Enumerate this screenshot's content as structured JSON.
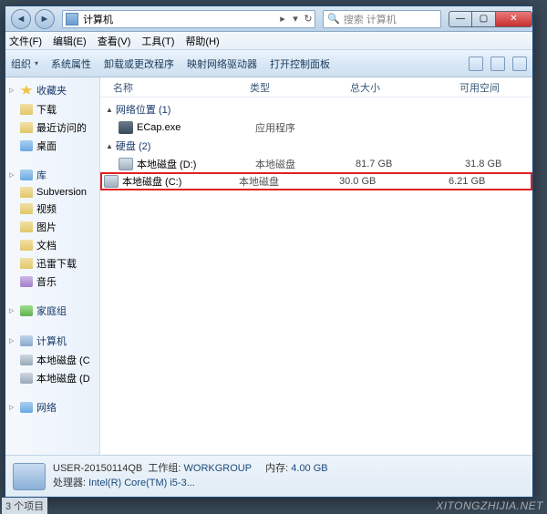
{
  "title_controls": {
    "min": "—",
    "max": "▢",
    "close": "✕"
  },
  "address": {
    "location": "计算机",
    "sep": "▸",
    "refresh": "↻"
  },
  "search": {
    "placeholder": "搜索 计算机"
  },
  "menubar": [
    "文件(F)",
    "编辑(E)",
    "查看(V)",
    "工具(T)",
    "帮助(H)"
  ],
  "toolbar": {
    "items": [
      "组织",
      "系统属性",
      "卸载或更改程序",
      "映射网络驱动器",
      "打开控制面板"
    ]
  },
  "navpane": {
    "favorites": {
      "title": "收藏夹",
      "items": [
        "下载",
        "最近访问的",
        "桌面"
      ]
    },
    "libraries": {
      "title": "库",
      "items": [
        "Subversion",
        "视频",
        "图片",
        "文档",
        "迅雷下载",
        "音乐"
      ]
    },
    "homegroup": {
      "title": "家庭组"
    },
    "computer": {
      "title": "计算机",
      "items": [
        "本地磁盘 (C",
        "本地磁盘 (D"
      ]
    },
    "network": {
      "title": "网络"
    }
  },
  "columns": {
    "name": "名称",
    "type": "类型",
    "total": "总大小",
    "free": "可用空间"
  },
  "groups": {
    "netloc": {
      "label": "网络位置 (1)",
      "items": [
        {
          "name": "ECap.exe",
          "type": "应用程序",
          "total": "",
          "free": "",
          "icon": "app"
        }
      ]
    },
    "disks": {
      "label": "硬盘 (2)",
      "items": [
        {
          "name": "本地磁盘 (D:)",
          "type": "本地磁盘",
          "total": "81.7 GB",
          "free": "31.8 GB",
          "icon": "drv",
          "hl": false
        },
        {
          "name": "本地磁盘 (C:)",
          "type": "本地磁盘",
          "total": "30.0 GB",
          "free": "6.21 GB",
          "icon": "drv",
          "hl": true
        }
      ]
    }
  },
  "footer": {
    "computer_name": "USER-20150114QB",
    "workgroup_label": "工作组:",
    "workgroup": "WORKGROUP",
    "memory_label": "内存:",
    "memory": "4.00 GB",
    "cpu_label": "处理器:",
    "cpu": "Intel(R) Core(TM) i5-3..."
  },
  "statusbar": "3 个项目",
  "watermark": "XITONGZHIJIA.NET"
}
